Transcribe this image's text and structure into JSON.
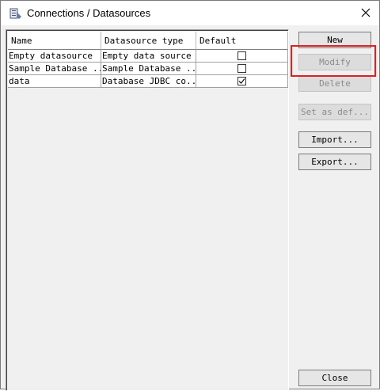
{
  "window": {
    "title": "Connections / Datasources",
    "app_icon": "datasource-app-icon",
    "close_icon": "close-icon"
  },
  "table": {
    "columns": [
      "Name",
      "Datasource type",
      "Default"
    ],
    "rows": [
      {
        "name": "Empty datasource",
        "type": "Empty data source",
        "default": false
      },
      {
        "name": "Sample Database ...",
        "type": "Sample Database ...",
        "default": false
      },
      {
        "name": "data",
        "type": "Database JDBC co...",
        "default": true
      }
    ]
  },
  "buttons": {
    "new": "New",
    "modify": "Modify",
    "delete": "Delete",
    "set_default": "Set as def...",
    "import": "Import...",
    "export": "Export...",
    "close": "Close"
  },
  "colors": {
    "highlight": "#e02020"
  }
}
